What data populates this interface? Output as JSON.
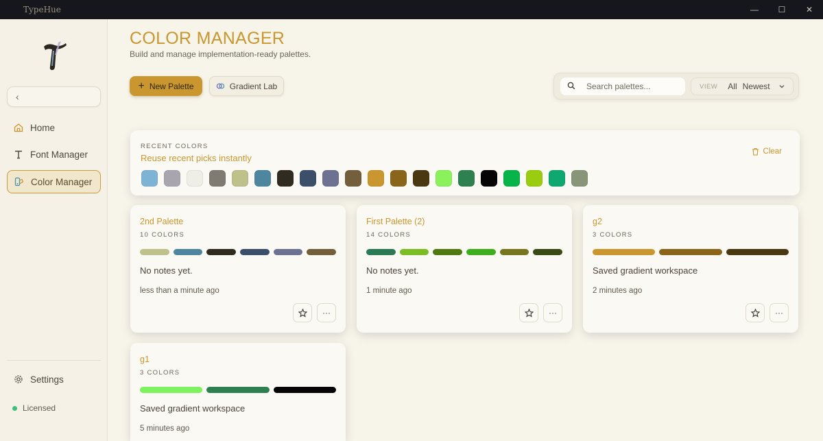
{
  "app": {
    "title": "TypeHue"
  },
  "window_controls": {
    "minimize": "—",
    "maximize": "☐",
    "close": "✕"
  },
  "sidebar": {
    "back_label": "‹",
    "items": [
      {
        "label": "Home",
        "icon": "home-icon",
        "active": false
      },
      {
        "label": "Font Manager",
        "icon": "type-icon",
        "active": false
      },
      {
        "label": "Color Manager",
        "icon": "palette-icon",
        "active": true
      }
    ],
    "settings_label": "Settings",
    "license_label": "Licensed",
    "license_color": "#3cc07a"
  },
  "header": {
    "title": "COLOR MANAGER",
    "subtitle": "Build and manage implementation-ready palettes."
  },
  "toolbar": {
    "new_palette_label": "New Palette",
    "gradient_lab_label": "Gradient Lab",
    "search_placeholder": "Search palettes...",
    "view_label": "VIEW",
    "view_filter": "All",
    "view_sort": "Newest"
  },
  "recent": {
    "label": "RECENT COLORS",
    "subtitle": "Reuse recent picks instantly",
    "clear_label": "Clear",
    "colors": [
      "#7fb3d6",
      "#a8a5ae",
      "#eeeee6",
      "#7f7a72",
      "#bfc18b",
      "#4e86a0",
      "#2f2b1e",
      "#3b4f6a",
      "#6d7192",
      "#735f3c",
      "#c9962f",
      "#8a6418",
      "#4a3810",
      "#8cf25c",
      "#2f8050",
      "#050505",
      "#07b44a",
      "#9acd0f",
      "#0fa870",
      "#899578"
    ]
  },
  "palettes": [
    {
      "name": "2nd Palette",
      "count": "10 COLORS",
      "colors": [
        "#bfc18b",
        "#4e86a0",
        "#2f2b1e",
        "#3b4f6a",
        "#6d7192",
        "#735f3c"
      ],
      "notes": "No notes yet.",
      "time": "less than a minute ago"
    },
    {
      "name": "First Palette (2)",
      "count": "14 COLORS",
      "colors": [
        "#2b7a55",
        "#7bbd22",
        "#4f7a12",
        "#3fae1e",
        "#767620",
        "#3a4a14"
      ],
      "notes": "No notes yet.",
      "time": "1 minute ago"
    },
    {
      "name": "g2",
      "count": "3 COLORS",
      "colors": [
        "#c9962f",
        "#8a6418",
        "#4a3810"
      ],
      "notes": "Saved gradient workspace",
      "time": "2 minutes ago"
    },
    {
      "name": "g1",
      "count": "3 COLORS",
      "colors": [
        "#7cf25c",
        "#2f8050",
        "#050505"
      ],
      "notes": "Saved gradient workspace",
      "time": "5 minutes ago"
    }
  ],
  "card_actions": {
    "favorite_icon": "star-icon",
    "more_label": "···"
  },
  "accent_color": "#c9962f"
}
